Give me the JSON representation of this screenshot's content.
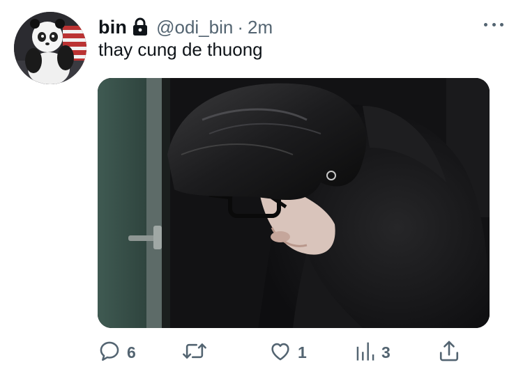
{
  "tweet": {
    "display_name": "bin",
    "handle": "@odi_bin",
    "separator": "·",
    "time": "2m",
    "text": "thay cung de thuong",
    "protected_icon": "lock-icon",
    "menu_icon": "more-horizontal-icon"
  },
  "actions": {
    "reply": {
      "icon": "reply-icon",
      "count": "6"
    },
    "retweet": {
      "icon": "retweet-icon",
      "count": ""
    },
    "like": {
      "icon": "heart-icon",
      "count": "1"
    },
    "views": {
      "icon": "analytics-icon",
      "count": "3"
    },
    "share": {
      "icon": "share-icon"
    }
  },
  "colors": {
    "text_primary": "#0f1419",
    "text_secondary": "#536471",
    "background": "#ffffff"
  }
}
